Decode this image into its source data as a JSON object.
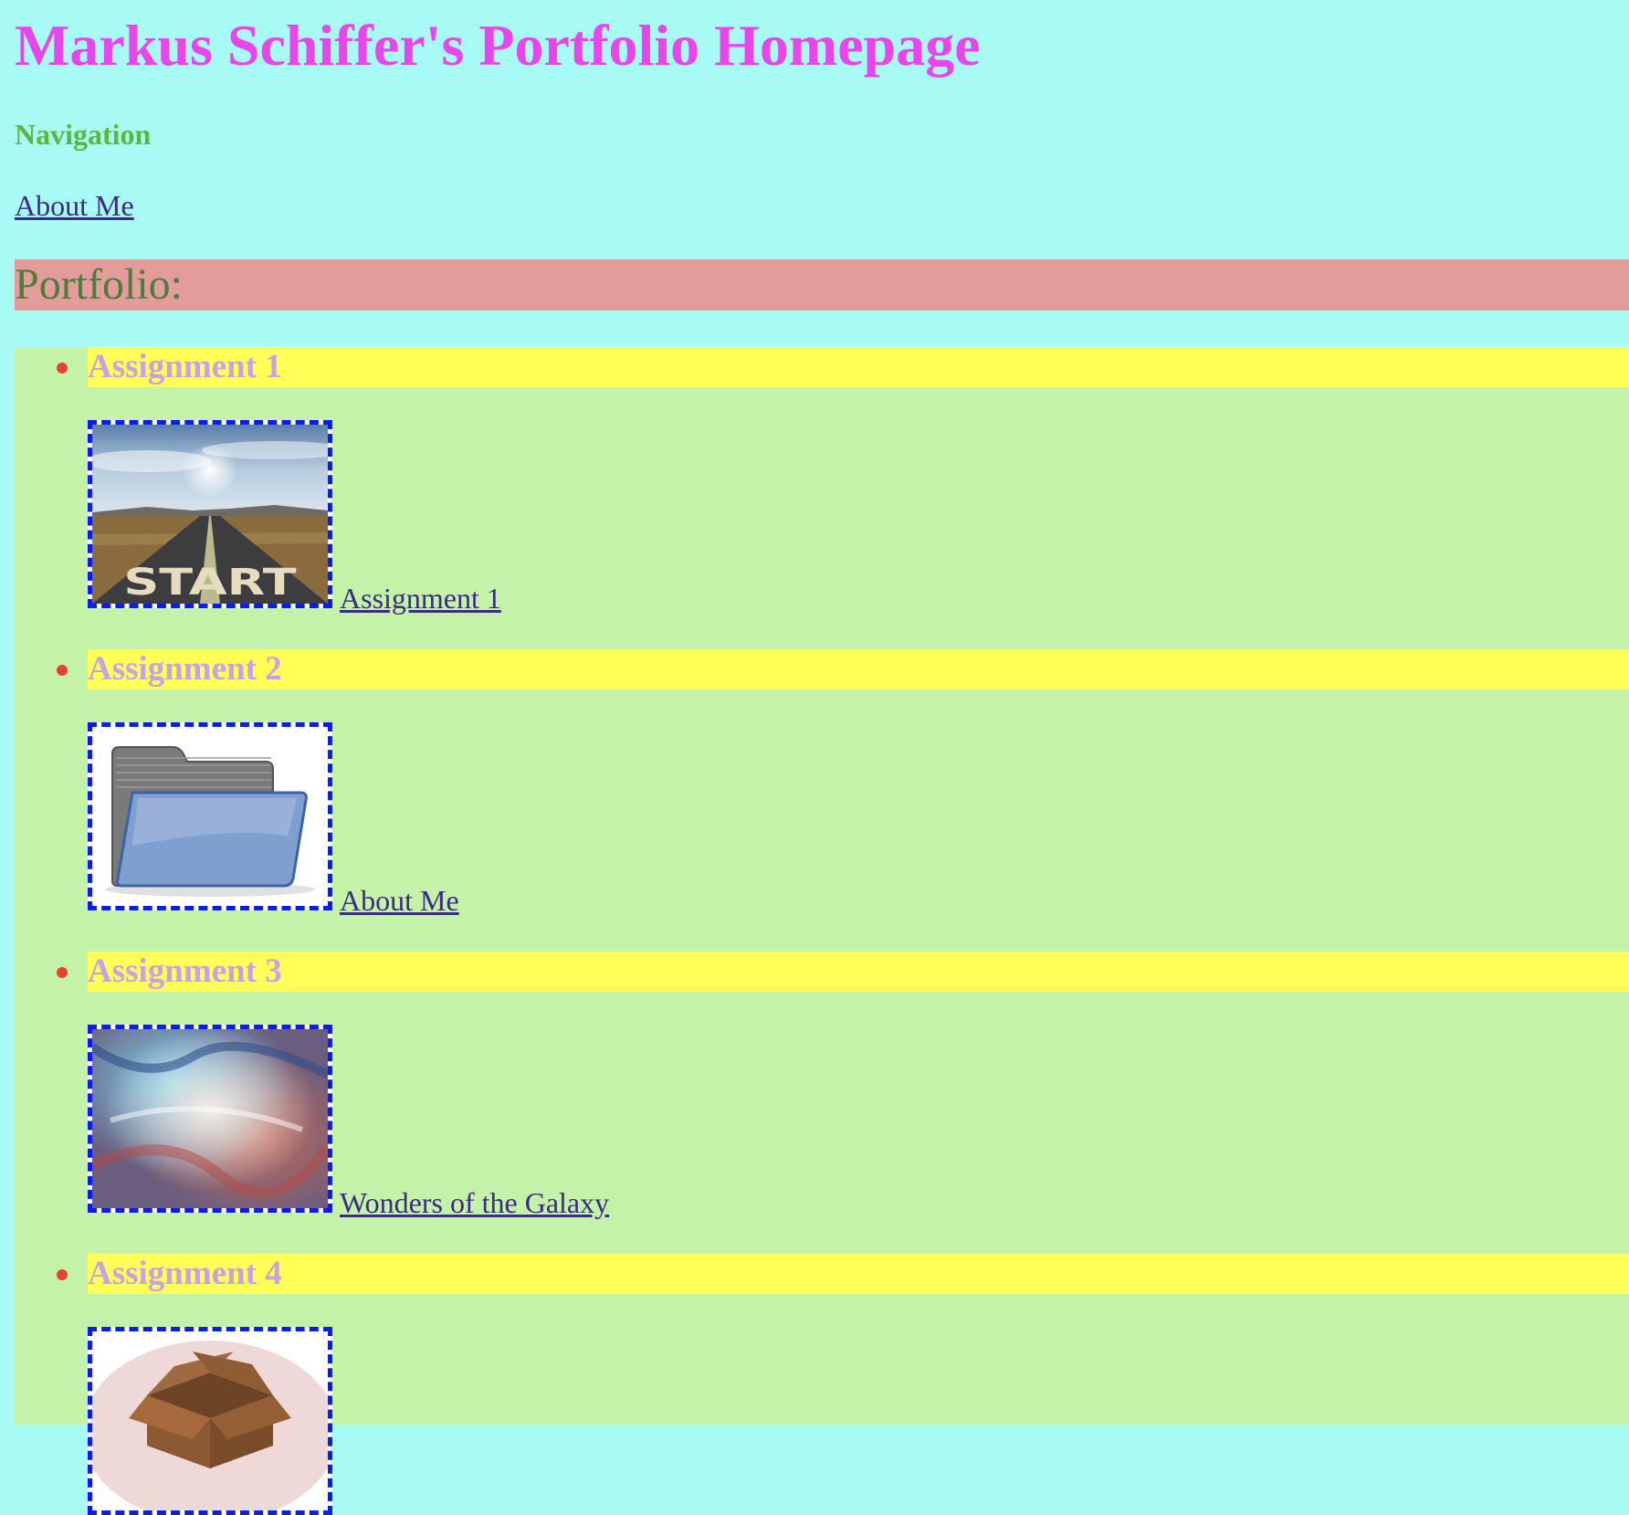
{
  "header": {
    "title": "Markus Schiffer's Portfolio Homepage"
  },
  "navigation": {
    "heading": "Navigation",
    "link_label": "About Me"
  },
  "portfolio": {
    "heading": "Portfolio:",
    "items": [
      {
        "heading": "Assignment 1",
        "link_label": "Assignment 1",
        "image": "start-road-image"
      },
      {
        "heading": "Assignment 2",
        "link_label": "About Me",
        "image": "folder-icon"
      },
      {
        "heading": "Assignment 3",
        "link_label": "Wonders of the Galaxy",
        "image": "galaxy-image"
      },
      {
        "heading": "Assignment 4",
        "link_label": "",
        "image": "open-box-icon"
      }
    ]
  },
  "colors": {
    "page_background": "#a8fbf5",
    "title": "#e845ea",
    "nav_heading": "#5ab83d",
    "link": "#3c2a86",
    "section_bar": "#e39b9b",
    "section_text": "#4b7d3d",
    "list_background": "#c4f2a8",
    "item_heading_background": "#ffff57",
    "item_heading_text": "#c6a2e8",
    "bullet": "#e8432e",
    "thumb_border": "#0a1cf0"
  }
}
